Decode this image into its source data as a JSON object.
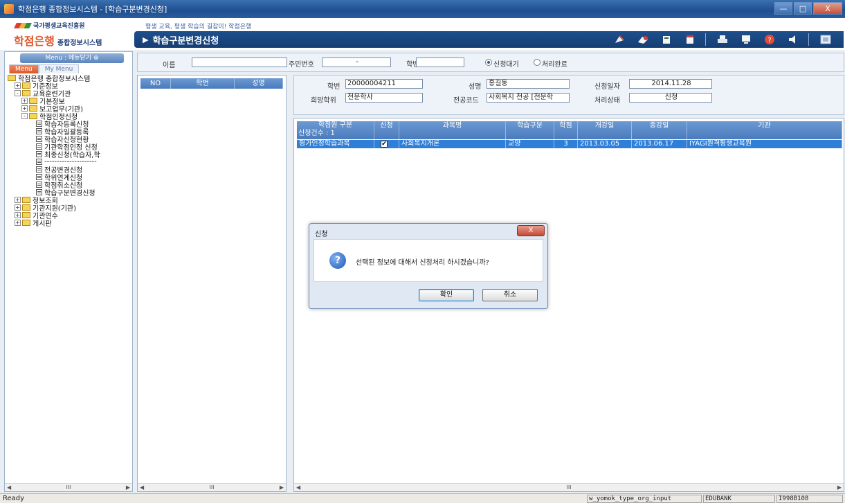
{
  "window": {
    "title": "학점은행 종합정보시스템 - [학습구분변경신청]",
    "minimize": "—",
    "maximize": "□",
    "close": "X"
  },
  "header": {
    "org_name": "국가평생교육진흥원",
    "logo_main": "학점은행",
    "logo_sub": "종합정보시스템",
    "slogan": "평생 교육, 평생 학습의 길잡이! 학점은행",
    "page_title": "학습구분변경신청"
  },
  "left": {
    "menu_button": "Menu : 메뉴닫기 ⊗",
    "tabs": [
      "Menu",
      "My Menu"
    ],
    "tree": [
      {
        "label": "학점은행 종합정보시스템",
        "level": 0,
        "type": "folder",
        "exp": ""
      },
      {
        "label": "기준정보",
        "level": 1,
        "type": "folder",
        "exp": "+"
      },
      {
        "label": "교육훈련기관",
        "level": 1,
        "type": "folder",
        "exp": "-"
      },
      {
        "label": "기본정보",
        "level": 2,
        "type": "folder",
        "exp": "+"
      },
      {
        "label": "보고업무(기관)",
        "level": 2,
        "type": "folder",
        "exp": "+"
      },
      {
        "label": "학점인정신청",
        "level": 2,
        "type": "folder",
        "exp": "-"
      },
      {
        "label": "학습자등록신청",
        "level": 3,
        "type": "doc",
        "exp": ""
      },
      {
        "label": "학습자일괄등록",
        "level": 3,
        "type": "doc",
        "exp": ""
      },
      {
        "label": "학습자신청현황",
        "level": 3,
        "type": "doc",
        "exp": ""
      },
      {
        "label": "기관학점인정 신청",
        "level": 3,
        "type": "doc",
        "exp": ""
      },
      {
        "label": "최종신청(학습자,학",
        "level": 3,
        "type": "doc",
        "exp": ""
      },
      {
        "label": "---------------------",
        "level": 3,
        "type": "doc",
        "exp": ""
      },
      {
        "label": "전공변경신청",
        "level": 3,
        "type": "doc",
        "exp": ""
      },
      {
        "label": "학위연계신청",
        "level": 3,
        "type": "doc",
        "exp": ""
      },
      {
        "label": "학점취소신청",
        "level": 3,
        "type": "doc",
        "exp": ""
      },
      {
        "label": "학습구분변경신청",
        "level": 3,
        "type": "doc",
        "exp": ""
      },
      {
        "label": "정보조회",
        "level": 1,
        "type": "folder",
        "exp": "+"
      },
      {
        "label": "기관지원(기관)",
        "level": 1,
        "type": "folder",
        "exp": "+"
      },
      {
        "label": "기관연수",
        "level": 1,
        "type": "folder",
        "exp": "+"
      },
      {
        "label": "게시판",
        "level": 1,
        "type": "folder",
        "exp": "+"
      }
    ],
    "scroll_mid": "III"
  },
  "search": {
    "name_label": "이름",
    "name_value": "",
    "rrn_label": "주민번호",
    "rrn_sep": "-",
    "student_no_label": "학번",
    "student_no_value": "",
    "radio_waiting": "신청대기",
    "radio_done": "처리완료"
  },
  "middle_list": {
    "columns": [
      "NO",
      "학번",
      "성명"
    ],
    "scroll_mid": "III"
  },
  "detail": {
    "student_no_label": "학번",
    "student_no": "20000004211",
    "name_label": "성명",
    "name": "홍길동",
    "apply_date_label": "신청일자",
    "apply_date": "2014.11.28",
    "degree_label": "희망학위",
    "degree": "전문학사",
    "major_label": "전공코드",
    "major": "사회복지 전공 [전문학",
    "status_label": "처리상태",
    "status": "신청"
  },
  "grid": {
    "columns": [
      "학점원 구분",
      "신청",
      "과목명",
      "학습구분",
      "학점",
      "개강일",
      "종강일",
      "기관"
    ],
    "count_label": "신청건수 : 1",
    "rows": [
      {
        "type": "평가인정학습과목",
        "checked": "✔",
        "subject": "사회복지개론",
        "category": "교양",
        "credit": "3",
        "start": "2013.03.05",
        "end": "2013.06.17",
        "org": "IYAGI원격평생교육원"
      }
    ],
    "scroll_mid": "III"
  },
  "dialog": {
    "title": "신청",
    "close": "X",
    "message": "선택된 정보에 대해서 신청처리 하시겠습니까?",
    "ok": "확인",
    "cancel": "취소"
  },
  "status": {
    "ready": "Ready",
    "object": "w_yomok_type_org_input",
    "db": "EDUBANK",
    "user": "I998B108"
  }
}
